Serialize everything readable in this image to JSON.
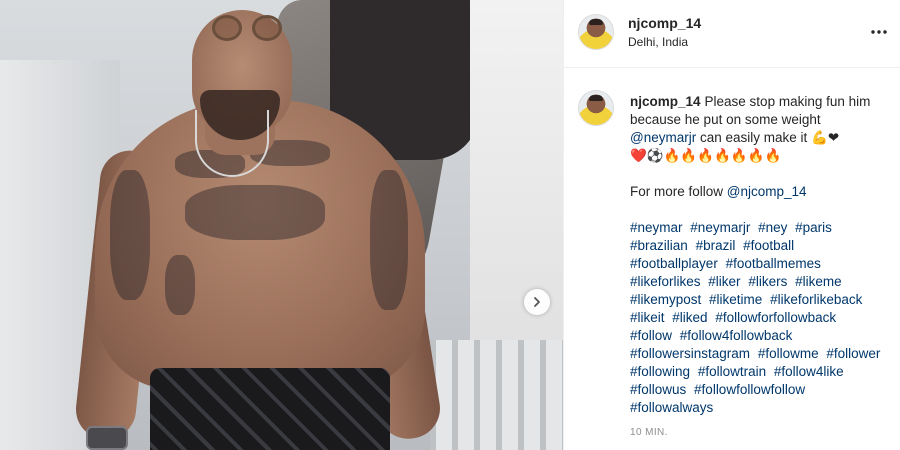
{
  "post": {
    "username": "njcomp_14",
    "location": "Delhi, India"
  },
  "caption": {
    "username": "njcomp_14",
    "text_line1": "Please stop making fun him because he put on some weight",
    "mention": "@neymarjr",
    "text_line2": "can easily make it",
    "emoji_row1": "💪❤",
    "emoji_row2": "❤️⚽🔥🔥🔥🔥🔥🔥🔥",
    "follow_text": "For more follow",
    "follow_mention": "@njcomp_14",
    "hashtags": [
      "#neymar",
      "#neymarjr",
      "#ney",
      "#paris",
      "#brazilian",
      "#brazil",
      "#football",
      "#footballplayer",
      "#footballmemes",
      "#likeforlikes",
      "#liker",
      "#likers",
      "#likeme",
      "#likemypost",
      "#liketime",
      "#likeforlikeback",
      "#likeit",
      "#liked",
      "#followforfollowback",
      "#follow",
      "#follow4followback",
      "#followersinstagram",
      "#followme",
      "#follower",
      "#following",
      "#followtrain",
      "#follow4like",
      "#followus",
      "#followfollowfollow",
      "#followalways"
    ]
  },
  "timestamp": "10 MIN.",
  "icons": {
    "more": "more-options-icon",
    "next": "chevron-right-icon"
  },
  "colors": {
    "link": "#00376b",
    "text": "#262626",
    "muted": "#8e8e8e"
  }
}
